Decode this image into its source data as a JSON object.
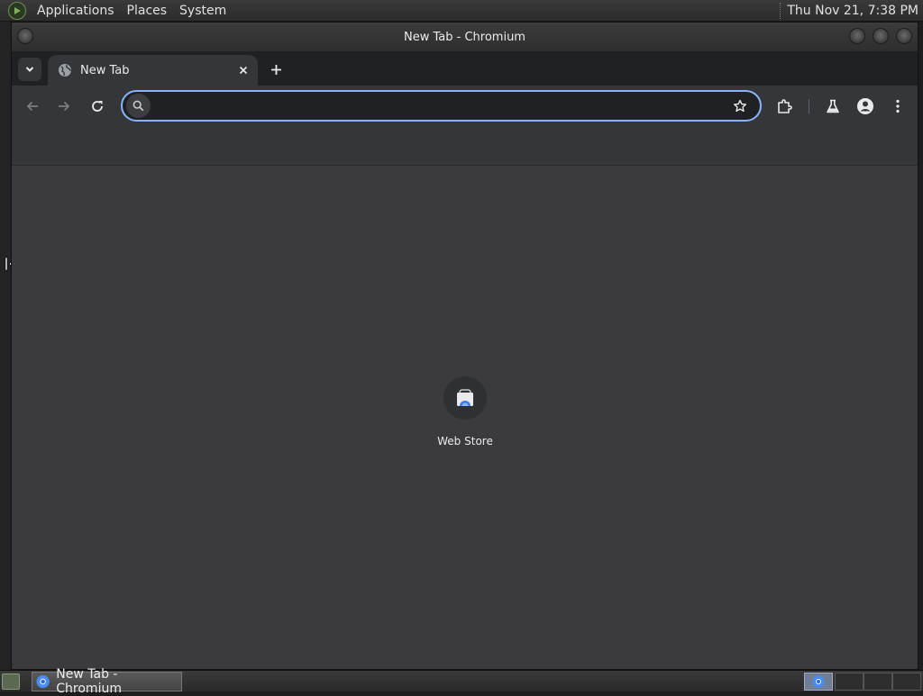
{
  "top_panel": {
    "menus": [
      "Applications",
      "Places",
      "System"
    ],
    "clock": "Thu Nov 21,  7:38 PM"
  },
  "window": {
    "title": "New Tab - Chromium"
  },
  "tabs": [
    {
      "title": "New Tab",
      "active": true
    }
  ],
  "omnibox": {
    "value": "",
    "placeholder": ""
  },
  "toolbar": {
    "icons": [
      "back-icon",
      "forward-icon",
      "reload-icon",
      "bookmark-star-icon",
      "extensions-icon",
      "labs-flask-icon",
      "profile-icon",
      "menu-kebab-icon"
    ]
  },
  "new_tab_page": {
    "shortcuts": [
      {
        "label": "Web Store",
        "icon": "web-store-icon"
      }
    ]
  },
  "taskbar": {
    "tasks": [
      {
        "label": "New Tab - Chromium",
        "icon": "chromium-icon"
      }
    ]
  },
  "colors": {
    "accent": "#8ab4f8",
    "tabstrip": "#202124",
    "toolbar": "#35363a",
    "content": "#3b3b3f"
  }
}
